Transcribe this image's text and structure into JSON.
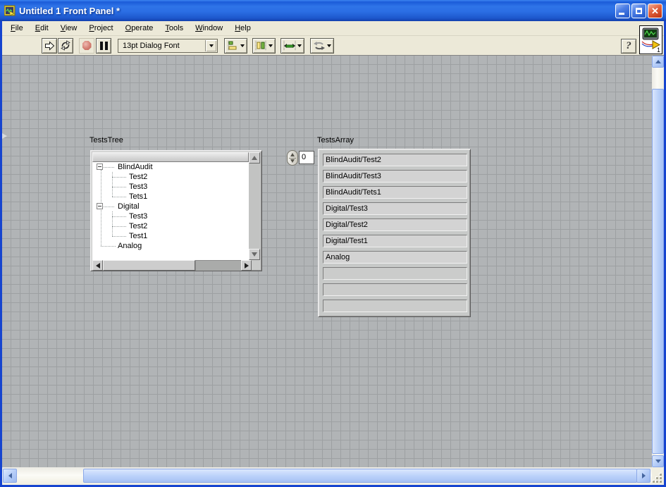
{
  "title_bar": {
    "title": "Untitled 1 Front Panel *",
    "buttons": [
      "minimize",
      "maximize",
      "close"
    ],
    "close_glyph": "x"
  },
  "menu_bar": {
    "items": [
      "File",
      "Edit",
      "View",
      "Project",
      "Operate",
      "Tools",
      "Window",
      "Help"
    ]
  },
  "toolbar": {
    "font_ring_value": "13pt Dialog Font",
    "help_glyph": "?",
    "vi_window_number": "1",
    "icons": [
      "run-icon",
      "run-continuously-icon",
      "abort-icon",
      "pause-icon",
      "align-objects-icon",
      "distribute-objects-icon",
      "resize-objects-icon",
      "reorder-icon",
      "context-help-icon",
      "vi-icon"
    ]
  },
  "front_panel": {
    "tree": {
      "label": "TestsTree",
      "nodes": [
        {
          "label": "BlindAudit",
          "expanded": true,
          "children": [
            "Test2",
            "Test3",
            "Tets1"
          ]
        },
        {
          "label": "Digital",
          "expanded": true,
          "children": [
            "Test3",
            "Test2",
            "Test1"
          ]
        },
        {
          "label": "Analog",
          "expanded": false,
          "children": []
        }
      ]
    },
    "array": {
      "label": "TestsArray",
      "index_value": "0",
      "elements": [
        "BlindAudit/Test2",
        "BlindAudit/Test3",
        "BlindAudit/Tets1",
        "Digital/Test3",
        "Digital/Test2",
        "Digital/Test1",
        "Analog"
      ],
      "empty_rows": 3
    }
  },
  "colors": {
    "titlebar_blue": "#2b6ee4",
    "window_border_blue": "#1644cf",
    "toolbar_beige": "#ece9d8",
    "panel_gray": "#b1b4b6",
    "grid_line_gray": "#9da0a2",
    "control_gray": "#c9cac9",
    "array_element_gray": "#d3d3d3",
    "abort_red": "#cf6a5f",
    "xp_scroll_thumb_blue": "#bcd2fa"
  }
}
